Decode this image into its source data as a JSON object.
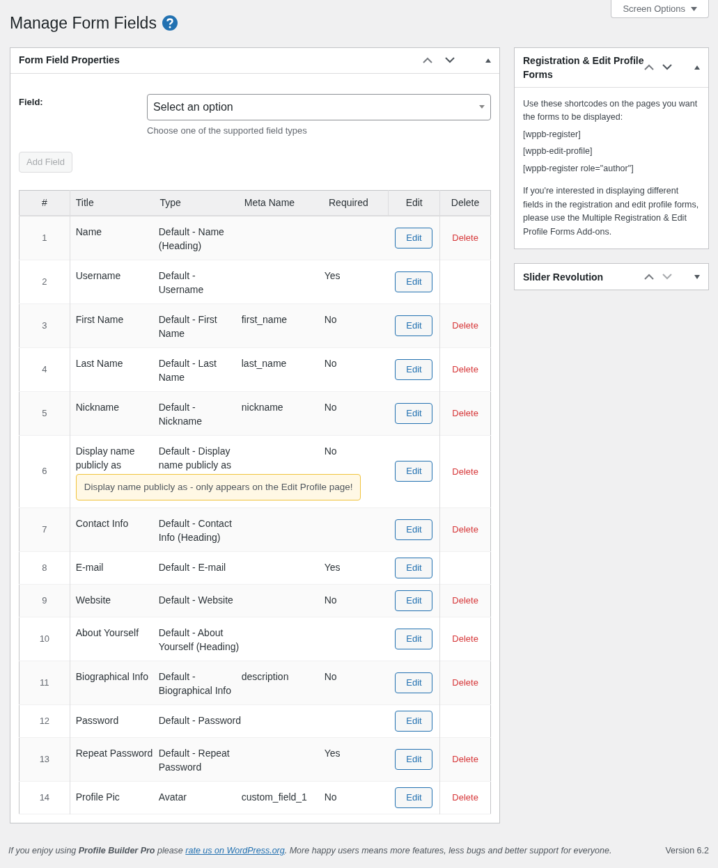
{
  "page_title": "Manage Form Fields",
  "screen_options": {
    "label": "Screen Options"
  },
  "main_panel": {
    "title": "Form Field Properties",
    "expanded": true,
    "field_label": "Field:",
    "select": {
      "placeholder": "Select an option"
    },
    "hint": "Choose one of the supported field types",
    "add_button": {
      "label": "Add Field",
      "disabled": true
    },
    "table": {
      "columns": [
        "#",
        "Title",
        "Type",
        "Meta Name",
        "Required",
        "Edit",
        "Delete"
      ],
      "rows": [
        {
          "number": "1",
          "title": "Name",
          "type": "Default - Name (Heading)",
          "meta": "",
          "required": "",
          "edit": "Edit",
          "delete": "Delete"
        },
        {
          "number": "2",
          "title": "Username",
          "type": "Default - Username",
          "meta": "",
          "required": "Yes",
          "edit": "Edit",
          "delete": ""
        },
        {
          "number": "3",
          "title": "First Name",
          "type": "Default - First Name",
          "meta": "first_name",
          "required": "No",
          "edit": "Edit",
          "delete": "Delete"
        },
        {
          "number": "4",
          "title": "Last Name",
          "type": "Default - Last Name",
          "meta": "last_name",
          "required": "No",
          "edit": "Edit",
          "delete": "Delete"
        },
        {
          "number": "5",
          "title": "Nickname",
          "type": "Default - Nickname",
          "meta": "nickname",
          "required": "No",
          "edit": "Edit",
          "delete": "Delete"
        },
        {
          "number": "6",
          "title": "Display name publicly as",
          "type": "Default - Display name publicly as",
          "meta": "",
          "required": "No",
          "edit": "Edit",
          "delete": "Delete",
          "note": "Display name publicly as - only appears on the Edit Profile page!"
        },
        {
          "number": "7",
          "title": "Contact Info",
          "type": "Default - Contact Info (Heading)",
          "meta": "",
          "required": "",
          "edit": "Edit",
          "delete": "Delete"
        },
        {
          "number": "8",
          "title": "E-mail",
          "type": "Default - E-mail",
          "meta": "",
          "required": "Yes",
          "edit": "Edit",
          "delete": ""
        },
        {
          "number": "9",
          "title": "Website",
          "type": "Default - Website",
          "meta": "",
          "required": "No",
          "edit": "Edit",
          "delete": "Delete"
        },
        {
          "number": "10",
          "title": "About Yourself",
          "type": "Default - About Yourself (Heading)",
          "meta": "",
          "required": "",
          "edit": "Edit",
          "delete": "Delete"
        },
        {
          "number": "11",
          "title": "Biographical Info",
          "type": "Default - Biographical Info",
          "meta": "description",
          "required": "No",
          "edit": "Edit",
          "delete": "Delete"
        },
        {
          "number": "12",
          "title": "Password",
          "type": "Default - Password",
          "meta": "",
          "required": "",
          "edit": "Edit",
          "delete": ""
        },
        {
          "number": "13",
          "title": "Repeat Password",
          "type": "Default - Repeat Password",
          "meta": "",
          "required": "Yes",
          "edit": "Edit",
          "delete": "Delete"
        },
        {
          "number": "14",
          "title": "Profile Pic",
          "type": "Avatar",
          "meta": "custom_field_1",
          "required": "No",
          "edit": "Edit",
          "delete": "Delete"
        }
      ]
    }
  },
  "side_panels": [
    {
      "title": "Registration & Edit Profile Forms",
      "expanded": true,
      "intro": "Use these shortcodes on the pages you want the forms to be displayed:",
      "shortcodes": [
        "[wppb-register]",
        "[wppb-edit-profile]",
        "[wppb-register role=\"author\"]"
      ],
      "note": "If you're interested in displaying different fields in the registration and edit profile forms, please use the Multiple Registration & Edit Profile Forms Add-ons."
    },
    {
      "title": "Slider Revolution",
      "expanded": false
    }
  ],
  "footer": {
    "before": "If you enjoy using **Profile Builder Pro** please",
    "link": "rate us on WordPress.org",
    "after": ". More happy users means more features, less bugs and better support for everyone.",
    "version": "Version 6.2"
  }
}
